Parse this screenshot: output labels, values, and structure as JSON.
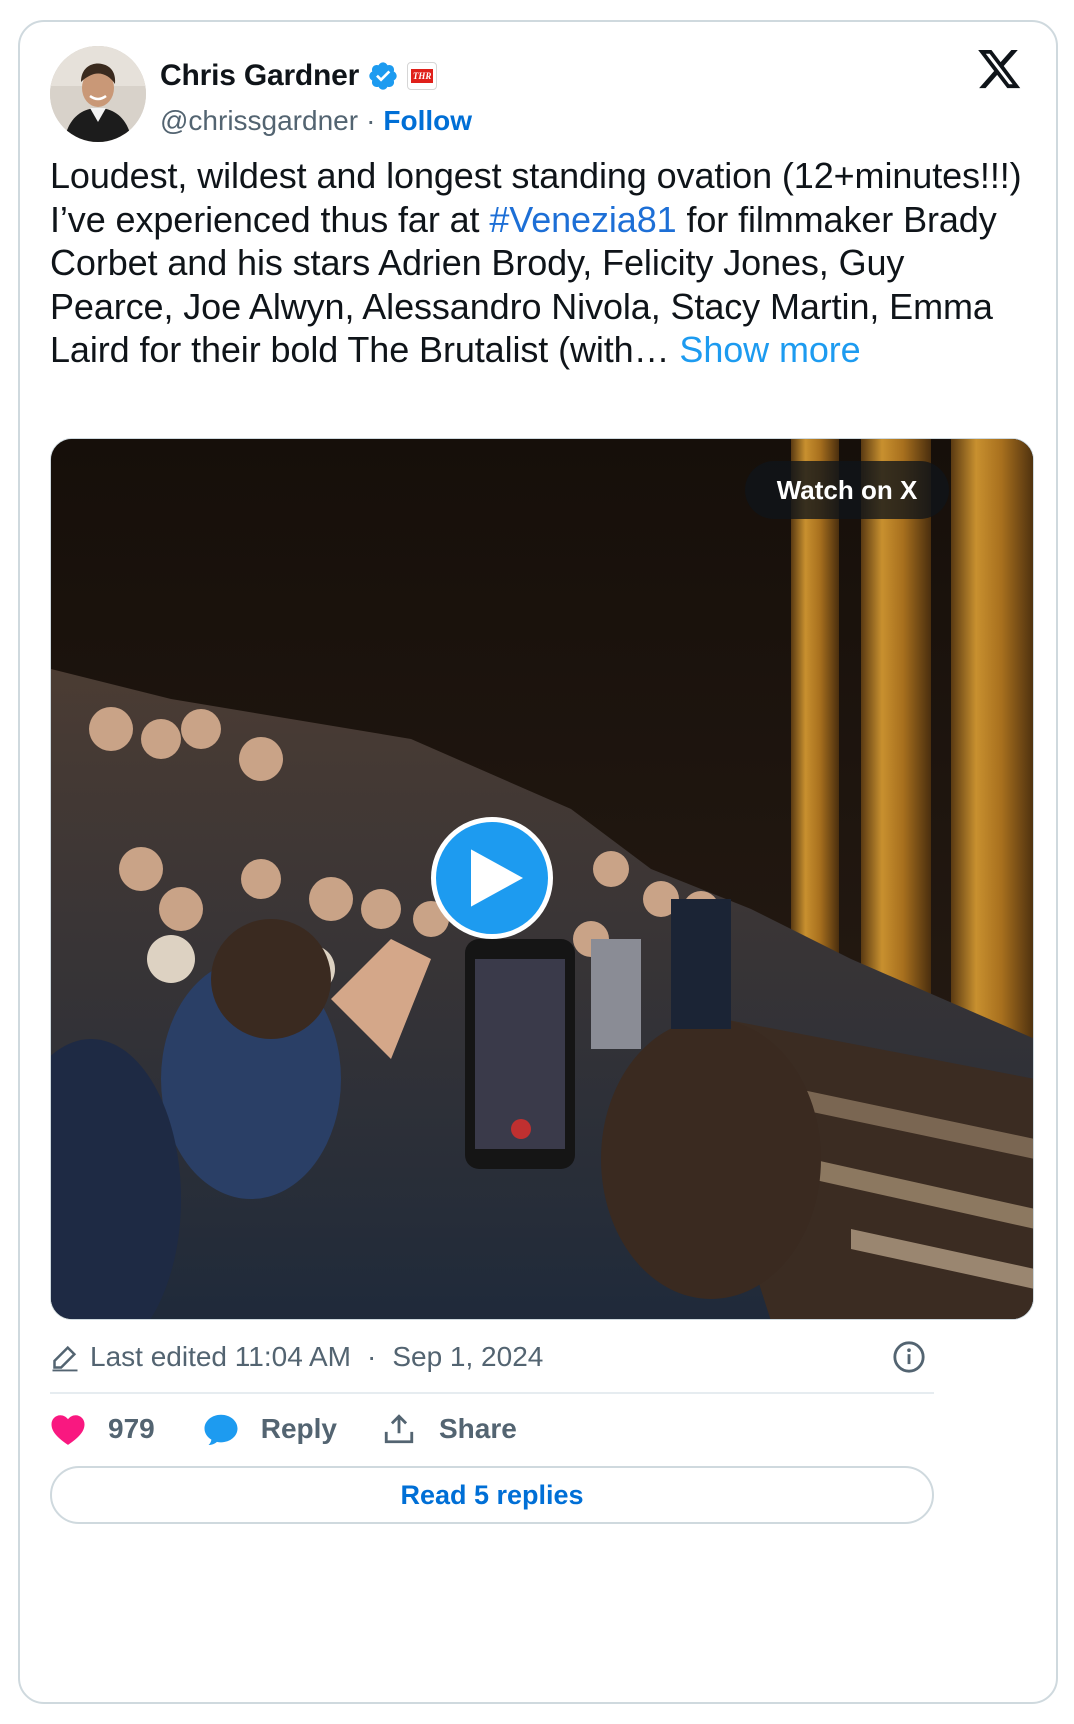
{
  "author": {
    "display_name": "Chris Gardner",
    "handle": "@chrissgardner",
    "separator": "·",
    "follow_label": "Follow",
    "affiliate_badge_text": "THR",
    "verified": true
  },
  "tweet": {
    "text_before_hashtag": "Loudest, wildest and longest standing ovation (12+minutes!!!) I’ve experienced thus far at ",
    "hashtag": "#Venezia81",
    "text_after_hashtag": " for filmmaker Brady Corbet and his stars Adrien Brody, Felicity Jones, Guy Pearce, Joe Alwyn, Alessandro Nivola, Stacy Martin, Emma Laird for their bold The Brutalist (with… ",
    "show_more_label": "Show more"
  },
  "media": {
    "watch_label": "Watch on X",
    "type": "video"
  },
  "meta": {
    "edited_label": "Last edited 11:04 AM",
    "separator": "·",
    "date": "Sep 1, 2024"
  },
  "actions": {
    "like_count": "979",
    "reply_label": "Reply",
    "share_label": "Share"
  },
  "read_replies_label": "Read 5 replies",
  "colors": {
    "accent": "#1d9bf0",
    "link": "#006fd6",
    "like": "#f91880",
    "border": "#cfd9de",
    "muted_text": "#536471"
  },
  "icons": [
    "verified-badge-icon",
    "x-logo-icon",
    "play-icon",
    "pencil-icon",
    "info-icon",
    "heart-icon",
    "reply-bubble-icon",
    "share-icon"
  ]
}
